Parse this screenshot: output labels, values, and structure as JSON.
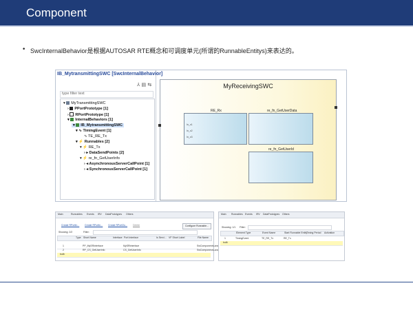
{
  "header": {
    "title": "Component"
  },
  "bullet": {
    "dot": "•",
    "text": "SwcInternalBehavior是根据AUTOSAR RTE概念和可调度单元(所谓的RunnableEntitys)来表达的。"
  },
  "tree_pane": {
    "title": "IB_MytransmittingSWC [SwcInternalBehavior]",
    "filter_placeholder": "type filter text",
    "nodes": [
      "MyTransmittingSWC",
      "PPortPrototype [1]",
      "RPortPrototype [1]",
      "InternalBehaviors [1]",
      "IB_MytransmittingSWC",
      "TimingEvent [1]",
      "TE_RE_Tx",
      "Runnables [2]",
      "RE_Tx",
      "DataSendPoints [2]",
      "re_fn_GetUserInfo",
      "AsynchronousServerCallPoint [1]",
      "SynchronousServerCallPoint [1]"
    ]
  },
  "canvas": {
    "swc_name": "MyReceivingSWC",
    "runnables": [
      {
        "label": "RE_Rx"
      },
      {
        "label": "re_fn_GetUserData"
      },
      {
        "label": "re_fn_GetUserId"
      }
    ]
  },
  "bottom_left": {
    "tabs": [
      "Main",
      "Runnables",
      "Events",
      "IRV",
      "DataPrototypes",
      "Others"
    ],
    "buttons": [
      "Create RPortIn...",
      "Create RPortIn...",
      "Create RPortOu...",
      "Delete"
    ],
    "configure_label": "Configure Runnable...",
    "showing": "Showing: 2/2",
    "filter": "Filter:",
    "columns": [
      "Type",
      "Short Name",
      "Interface",
      "Port Interface",
      "Is Servi...",
      "VF Short Label",
      "File Name"
    ],
    "rows": [
      {
        "idx": "1",
        "name": "PP_MySRInterface",
        "iface": "MySRInterface",
        "file": "SwComponents.arxml"
      },
      {
        "idx": "2",
        "name": "RP_CS_GetUserInfo",
        "iface": "CS_GetUserInfo",
        "file": "SwComponents.arxml"
      }
    ],
    "built_label": "built:"
  },
  "bottom_right": {
    "tabs": [
      "Main",
      "Runnables",
      "Events",
      "IRV",
      "DataPrototypes",
      "Others"
    ],
    "showing": "Showing: 1/1",
    "filter": "Filter:",
    "columns": [
      "Element Type",
      "Event Name",
      "Start Runnable Entity",
      "Timing Period",
      "Activation"
    ],
    "rows": [
      {
        "idx": "1",
        "type": "TimingEvent",
        "event": "TE_RE_Tx",
        "runnable": "RE_Tx"
      }
    ],
    "built_label": "built:"
  }
}
